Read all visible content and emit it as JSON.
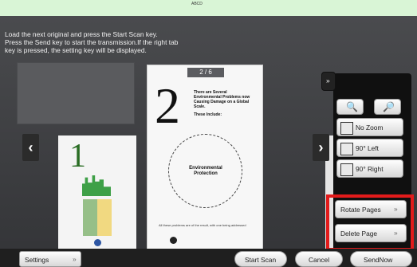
{
  "window": {
    "title_chars": "ABCD"
  },
  "message": {
    "line1": "Load the next original and press the Start Scan key.",
    "line2": "Press the Send key to start the transmission.If the right tab",
    "line3": "key is pressed, the setting key will be displayed."
  },
  "preview": {
    "page_counter": "2  /  6",
    "center_page": {
      "number": "2",
      "heading": "There are Several Environmental Problems now Causing Damage on a Global Scale.",
      "subheading": "These Include:",
      "callout": "Environmental Protection",
      "footer": "All these problems are of the result, with one being addressed"
    },
    "left_page": {
      "number": "1"
    }
  },
  "controls": {
    "expand_button": "»",
    "zoom_out": "zoom-out-icon",
    "zoom_in": "zoom-in-icon",
    "no_zoom": "No Zoom",
    "rotate_left": "90° Left",
    "rotate_right": "90° Right",
    "rotate_pages": "Rotate Pages",
    "delete_page": "Delete Page",
    "left_arrow": "‹",
    "right_arrow": "›"
  },
  "bottom": {
    "settings": "Settings",
    "start_scan": "Start Scan",
    "cancel": "Cancel",
    "send_now": "SendNow"
  },
  "colors": {
    "highlight": "#e31b1b",
    "status_bar": "#d9f5d6",
    "status_line": "#2fa84a"
  }
}
